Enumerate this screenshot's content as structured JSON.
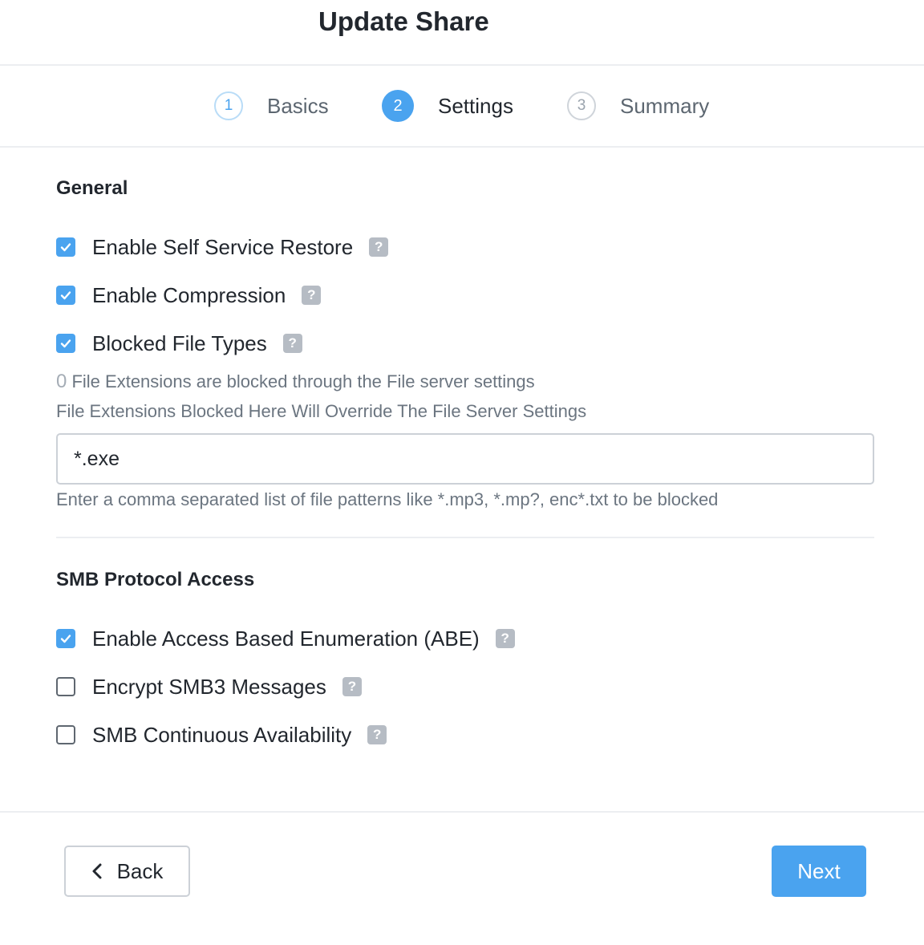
{
  "dialog": {
    "title": "Update Share"
  },
  "stepper": {
    "steps": [
      {
        "number": "1",
        "label": "Basics",
        "state": "completed"
      },
      {
        "number": "2",
        "label": "Settings",
        "state": "active"
      },
      {
        "number": "3",
        "label": "Summary",
        "state": "pending"
      }
    ]
  },
  "general": {
    "heading": "General",
    "options": [
      {
        "label": "Enable Self Service Restore",
        "checked": true
      },
      {
        "label": "Enable Compression",
        "checked": true
      },
      {
        "label": "Blocked File Types",
        "checked": true
      }
    ],
    "blocked_count": "0",
    "blocked_count_text": " File Extensions are blocked through the File server settings",
    "override_note": "File Extensions Blocked Here Will Override The File Server Settings",
    "blocked_input_value": "*.exe",
    "blocked_input_hint": "Enter a comma separated list of file patterns like *.mp3, *.mp?, enc*.txt to be blocked"
  },
  "smb": {
    "heading": "SMB Protocol Access",
    "options": [
      {
        "label": "Enable Access Based Enumeration (ABE)",
        "checked": true
      },
      {
        "label": "Encrypt SMB3 Messages",
        "checked": false
      },
      {
        "label": "SMB Continuous Availability",
        "checked": false
      }
    ]
  },
  "help_icon_glyph": "?",
  "footer": {
    "back_label": "Back",
    "next_label": "Next"
  },
  "colors": {
    "accent": "#4aa3ef",
    "help_icon_bg": "#b6bcc4",
    "text_primary": "#22272e",
    "text_secondary": "#6b7580"
  }
}
